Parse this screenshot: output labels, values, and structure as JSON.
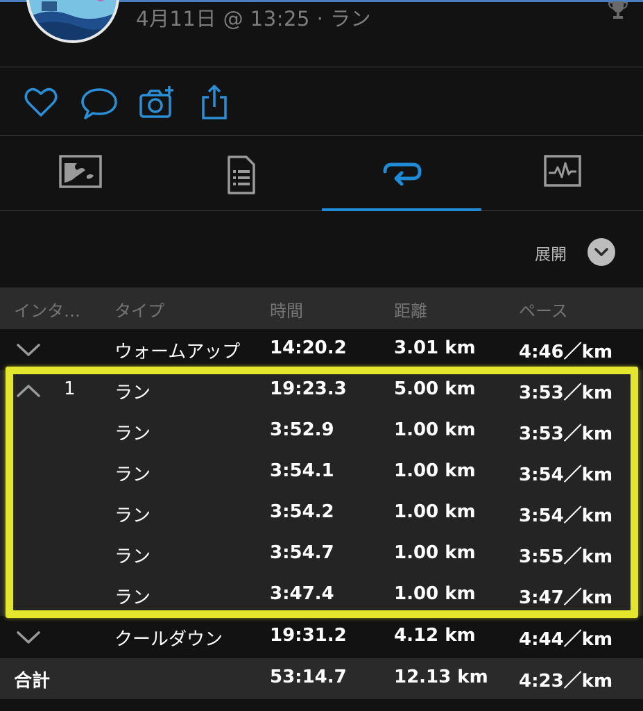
{
  "header": {
    "meta": "4月11日 @ 13:25 · ラン"
  },
  "actions": {
    "icons": [
      "heart-icon",
      "comment-icon",
      "camera-add-icon",
      "share-icon"
    ],
    "color": "#2b8fd8"
  },
  "tabs": {
    "items": [
      "map-icon",
      "details-icon",
      "laps-icon",
      "stats-icon"
    ],
    "active_index": 2
  },
  "expand": {
    "label": "展開"
  },
  "table": {
    "headers": [
      "インタ…",
      "タイプ",
      "時間",
      "距離",
      "ペース"
    ],
    "rows": [
      {
        "chevron": "down",
        "interval": "",
        "type": "ウォームアップ",
        "time": "14:20.2",
        "distance": "3.01 km",
        "pace": "4:46／km"
      },
      {
        "chevron": "up",
        "interval": "1",
        "type": "ラン",
        "time": "19:23.3",
        "distance": "5.00 km",
        "pace": "3:53／km"
      },
      {
        "chevron": "",
        "interval": "",
        "type": "ラン",
        "time": "3:52.9",
        "distance": "1.00 km",
        "pace": "3:53／km"
      },
      {
        "chevron": "",
        "interval": "",
        "type": "ラン",
        "time": "3:54.1",
        "distance": "1.00 km",
        "pace": "3:54／km"
      },
      {
        "chevron": "",
        "interval": "",
        "type": "ラン",
        "time": "3:54.2",
        "distance": "1.00 km",
        "pace": "3:54／km"
      },
      {
        "chevron": "",
        "interval": "",
        "type": "ラン",
        "time": "3:54.7",
        "distance": "1.00 km",
        "pace": "3:55／km"
      },
      {
        "chevron": "",
        "interval": "",
        "type": "ラン",
        "time": "3:47.4",
        "distance": "1.00 km",
        "pace": "3:47／km"
      },
      {
        "chevron": "down",
        "interval": "",
        "type": "クールダウン",
        "time": "19:31.2",
        "distance": "4.12 km",
        "pace": "4:44／km"
      }
    ],
    "total": {
      "label": "合計",
      "time": "53:14.7",
      "distance": "12.13 km",
      "pace": "4:23／km"
    }
  },
  "colors": {
    "accent": "#1f8ad6",
    "highlight": "#e4e62e",
    "background": "#121212"
  }
}
